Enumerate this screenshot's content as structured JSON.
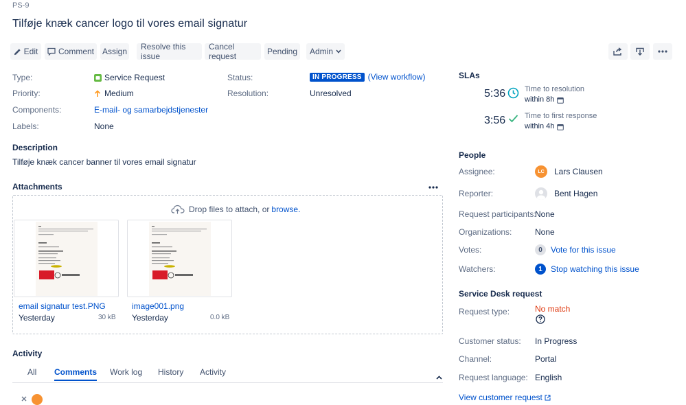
{
  "issue": {
    "key": "PS-9",
    "title": "Tilføje knæk cancer logo til vores email signatur"
  },
  "toolbar": {
    "edit": "Edit",
    "comment": "Comment",
    "assign": "Assign",
    "resolve": "Resolve this issue",
    "cancel": "Cancel request",
    "pending": "Pending",
    "admin": "Admin"
  },
  "details": {
    "type_label": "Type:",
    "type_value": "Service Request",
    "priority_label": "Priority:",
    "priority_value": "Medium",
    "components_label": "Components:",
    "components_value": "E-mail- og samarbejdstjenester",
    "labels_label": "Labels:",
    "labels_value": "None",
    "status_label": "Status:",
    "status_value": "IN PROGRESS",
    "status_workflow": "(View workflow)",
    "resolution_label": "Resolution:",
    "resolution_value": "Unresolved"
  },
  "description": {
    "title": "Description",
    "text": "Tilføje knæk cancer banner til vores email signatur"
  },
  "attachments": {
    "title": "Attachments",
    "drop_text": "Drop files to attach, or ",
    "browse": "browse.",
    "items": [
      {
        "name": "email signatur test.PNG",
        "date": "Yesterday",
        "size": "30 kB"
      },
      {
        "name": "image001.png",
        "date": "Yesterday",
        "size": "0.0 kB"
      }
    ]
  },
  "activity": {
    "title": "Activity",
    "tabs": [
      "All",
      "Comments",
      "Work log",
      "History",
      "Activity"
    ]
  },
  "slas": {
    "title": "SLAs",
    "items": [
      {
        "time": "5:36",
        "label": "Time to resolution",
        "within": "within 8h"
      },
      {
        "time": "3:56",
        "label": "Time to first response",
        "within": "within 4h"
      }
    ]
  },
  "people": {
    "title": "People",
    "assignee_label": "Assignee:",
    "assignee_initials": "LC",
    "assignee_value": "Lars Clausen",
    "reporter_label": "Reporter:",
    "reporter_value": "Bent Hagen",
    "participants_label": "Request participants:",
    "participants_value": "None",
    "organizations_label": "Organizations:",
    "organizations_value": "None",
    "votes_label": "Votes:",
    "votes_count": "0",
    "votes_action": "Vote for this issue",
    "watchers_label": "Watchers:",
    "watchers_count": "1",
    "watchers_action": "Stop watching this issue"
  },
  "service_desk": {
    "title": "Service Desk request",
    "request_type_label": "Request type:",
    "request_type_value": "No match",
    "customer_status_label": "Customer status:",
    "customer_status_value": "In Progress",
    "channel_label": "Channel:",
    "channel_value": "Portal",
    "language_label": "Request language:",
    "language_value": "English",
    "view_request": "View customer request"
  },
  "colors": {
    "accent": "#0052cc",
    "status_lozenge": "#0052cc",
    "service_request_icon": "#65ba43",
    "priority_medium": "#ff991f",
    "avatar_lc": "#f79232",
    "no_match": "#de350b"
  }
}
